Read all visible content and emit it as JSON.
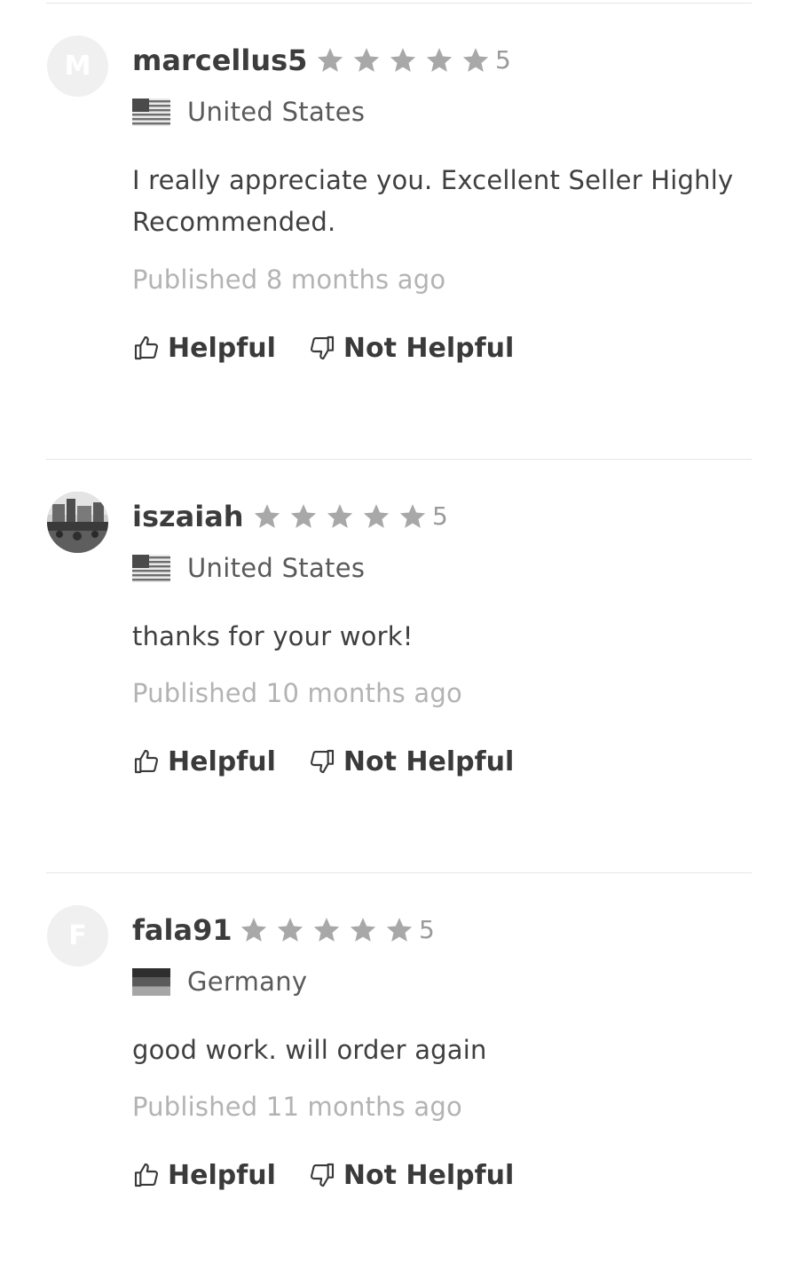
{
  "reviews": [
    {
      "avatar_letter": "M",
      "avatar_type": "letter",
      "username": "marcellus5",
      "stars": 5,
      "rating": "5",
      "flag_icon": "us-flag-icon",
      "country": "United States",
      "comment": "I really appreciate you. Excellent Seller Highly Recommended.",
      "published": "Published 8 months ago",
      "helpful_label": "Helpful",
      "not_helpful_label": "Not Helpful"
    },
    {
      "avatar_letter": "",
      "avatar_type": "photo",
      "username": "iszaiah",
      "stars": 5,
      "rating": "5",
      "flag_icon": "us-flag-icon",
      "country": "United States",
      "comment": "thanks for your work!",
      "published": "Published 10 months ago",
      "helpful_label": "Helpful",
      "not_helpful_label": "Not Helpful"
    },
    {
      "avatar_letter": "F",
      "avatar_type": "letter",
      "username": "fala91",
      "stars": 5,
      "rating": "5",
      "flag_icon": "germany-flag-icon",
      "country": "Germany",
      "comment": "good work. will order again",
      "published": "Published 11 months ago",
      "helpful_label": "Helpful",
      "not_helpful_label": "Not Helpful"
    }
  ],
  "colors": {
    "star": "#a8a8a8",
    "muted_text": "#b3b3b3",
    "divider": "#e6e6e6"
  }
}
